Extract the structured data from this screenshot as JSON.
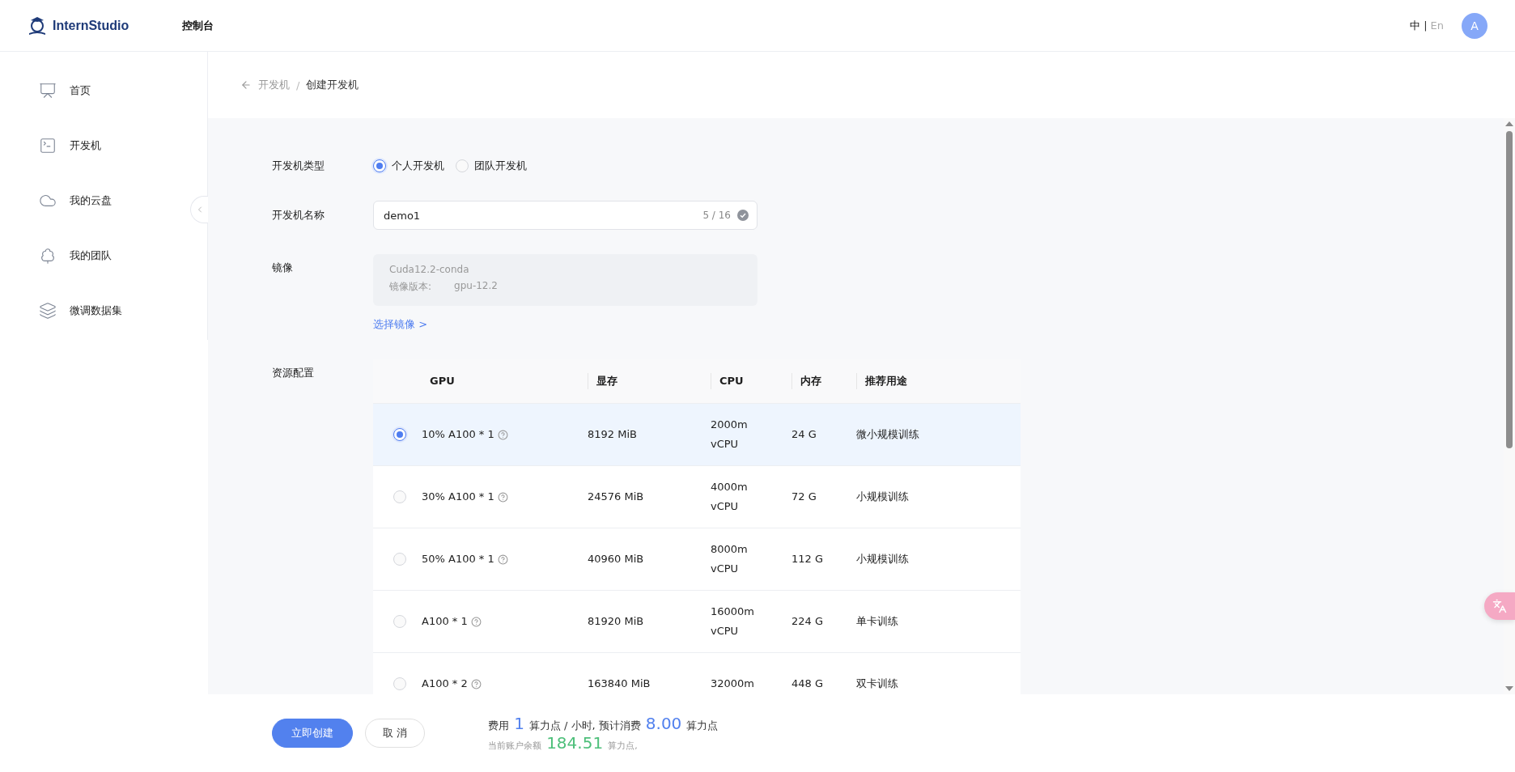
{
  "header": {
    "logo_text": "InternStudio",
    "nav_title": "控制台",
    "lang_options": [
      {
        "label": "中",
        "selected": true
      },
      {
        "label": "En",
        "selected": false
      }
    ],
    "lang_separator": "|",
    "avatar": "A"
  },
  "sidebar": {
    "items": [
      {
        "label": "首页",
        "kind": "home"
      },
      {
        "label": "开发机",
        "kind": "terminal"
      },
      {
        "label": "我的云盘",
        "kind": "cloud"
      },
      {
        "label": "我的团队",
        "kind": "tree"
      },
      {
        "label": "微调数据集",
        "kind": "layers"
      }
    ]
  },
  "breadcrumb": {
    "items": [
      "开发机",
      "创建开发机"
    ],
    "separator": "/"
  },
  "form": {
    "type_field": {
      "label": "开发机类型",
      "options": [
        {
          "label": "个人开发机",
          "selected": true
        },
        {
          "label": "团队开发机",
          "selected": false
        }
      ]
    },
    "name_field": {
      "label": "开发机名称",
      "value": "demo1",
      "counter": "5 / 16"
    },
    "image_field": {
      "label": "镜像",
      "image_name": "Cuda12.2-conda",
      "version_label": "镜像版本:",
      "version": "gpu-12.2",
      "select_link": "选择镜像 >"
    },
    "resources": {
      "label": "资源配置",
      "columns": [
        "GPU",
        "显存",
        "CPU",
        "内存",
        "推荐用途"
      ],
      "rows": [
        {
          "selected": true,
          "gpu": "10% A100 * 1",
          "vram": "8192 MiB",
          "cpu": [
            "2000m",
            "vCPU"
          ],
          "memory": "24 G",
          "usage": "微小规模训练"
        },
        {
          "selected": false,
          "gpu": "30% A100 * 1",
          "vram": "24576 MiB",
          "cpu": [
            "4000m",
            "vCPU"
          ],
          "memory": "72 G",
          "usage": "小规模训练"
        },
        {
          "selected": false,
          "gpu": "50% A100 * 1",
          "vram": "40960 MiB",
          "cpu": [
            "8000m",
            "vCPU"
          ],
          "memory": "112 G",
          "usage": "小规模训练"
        },
        {
          "selected": false,
          "gpu": "A100 * 1",
          "vram": "81920 MiB",
          "cpu": [
            "16000m",
            "vCPU"
          ],
          "memory": "224 G",
          "usage": "单卡训练"
        },
        {
          "selected": false,
          "gpu": "A100 * 2",
          "vram": "163840 MiB",
          "cpu": [
            "32000m"
          ],
          "memory": "448 G",
          "usage": "双卡训练"
        }
      ]
    }
  },
  "footer": {
    "buttons": [
      {
        "label": "立即创建",
        "kind": "primary"
      },
      {
        "label": "取 消",
        "kind": "default"
      }
    ],
    "cost_line": [
      {
        "text": "费用",
        "kind": "text"
      },
      {
        "text": "1",
        "kind": "amount"
      },
      {
        "text": "算力点 / 小时, 预计消费",
        "kind": "text"
      },
      {
        "text": "8.00",
        "kind": "amount"
      },
      {
        "text": "算力点",
        "kind": "text"
      }
    ],
    "balance_line": [
      {
        "text": "当前账户余额",
        "kind": "text"
      },
      {
        "text": "184.51",
        "kind": "balance"
      },
      {
        "text": "算力点,",
        "kind": "text"
      }
    ]
  }
}
